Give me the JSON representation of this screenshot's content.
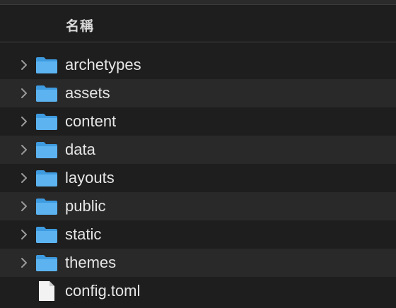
{
  "header": {
    "column_name": "名稱"
  },
  "items": [
    {
      "name": "archetypes",
      "kind": "folder",
      "icon": "folder-icon"
    },
    {
      "name": "assets",
      "kind": "folder",
      "icon": "folder-icon"
    },
    {
      "name": "content",
      "kind": "folder",
      "icon": "folder-icon"
    },
    {
      "name": "data",
      "kind": "folder",
      "icon": "folder-icon"
    },
    {
      "name": "layouts",
      "kind": "folder",
      "icon": "folder-icon"
    },
    {
      "name": "public",
      "kind": "folder",
      "icon": "folder-icon"
    },
    {
      "name": "static",
      "kind": "folder",
      "icon": "folder-icon"
    },
    {
      "name": "themes",
      "kind": "folder",
      "icon": "folder-icon"
    },
    {
      "name": "config.toml",
      "kind": "file",
      "icon": "document-icon"
    }
  ],
  "colors": {
    "background": "#1e1e1e",
    "row_alt": "#2a2929",
    "folder_blue": "#4aa5e8",
    "text": "#e6e6e6"
  }
}
